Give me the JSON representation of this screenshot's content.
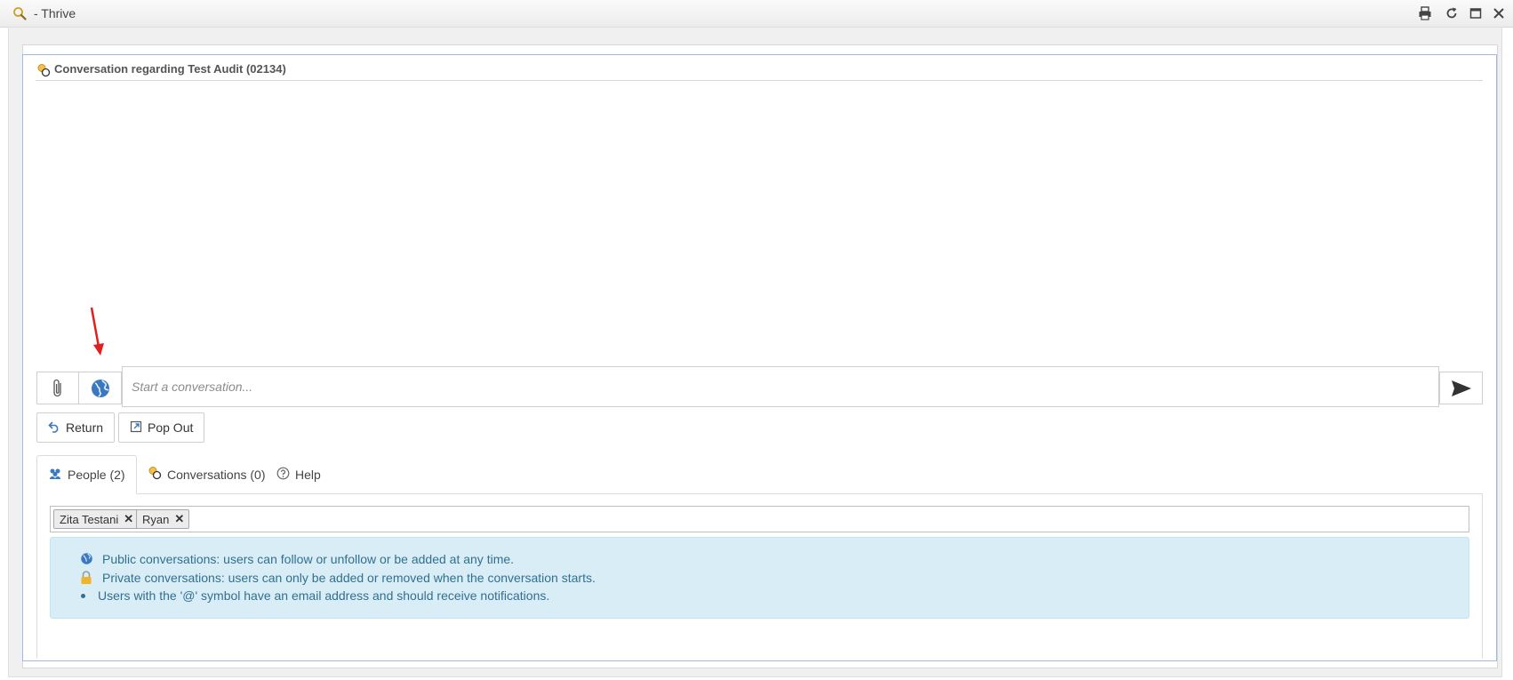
{
  "window": {
    "title": "- Thrive",
    "controls": [
      "print-icon",
      "refresh-icon",
      "maximize-icon",
      "close-icon"
    ]
  },
  "conversation": {
    "header": "Conversation regarding Test Audit (02134)",
    "input_placeholder": "Start a conversation..."
  },
  "toolbar": {
    "attach_icon": "paperclip-icon",
    "visibility_icon": "globe-icon",
    "send_icon": "send-icon"
  },
  "actions": {
    "return_label": "Return",
    "popout_label": "Pop Out"
  },
  "tabs": [
    {
      "label": "People (2)",
      "icon": "people-icon",
      "active": true
    },
    {
      "label": "Conversations (0)",
      "icon": "conversation-icon",
      "active": false
    },
    {
      "label": "Help",
      "icon": "help-icon",
      "active": false
    }
  ],
  "people": [
    {
      "name": "Zita Testani"
    },
    {
      "name": "Ryan"
    }
  ],
  "info": {
    "public": "Public conversations: users can follow or unfollow or be added at any time.",
    "private": "Private conversations: users can only be added or removed when the conversation starts.",
    "email": "Users with the '@' symbol have an email address and should receive notifications."
  },
  "colors": {
    "panel_border": "#9fb8e6",
    "info_background": "#d9edf7",
    "info_text": "#31708f",
    "annotation_arrow": "#e02020"
  }
}
